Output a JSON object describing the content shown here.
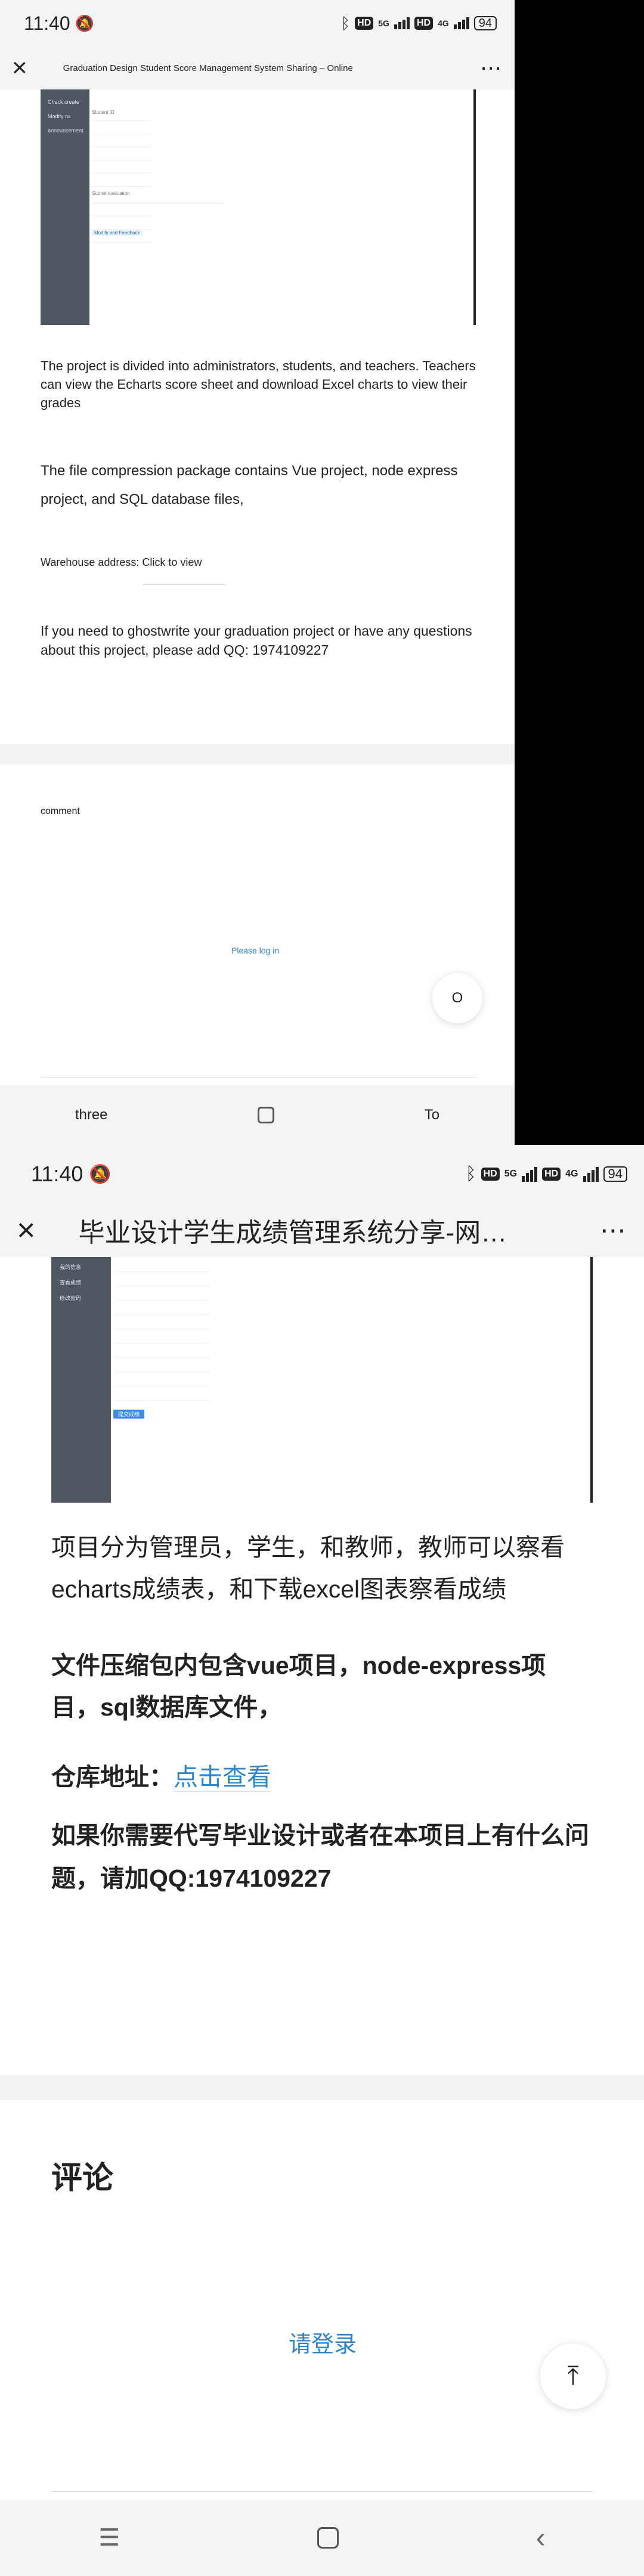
{
  "top": {
    "time": "11:40",
    "network_5g": "5G",
    "network_4g": "4G",
    "hd": "HD",
    "battery": "94",
    "title": "Graduation Design Student Score Management System Sharing – Online",
    "shot_texts": [
      "Check create",
      "Modify ru",
      "announcement",
      "Student ID",
      "Submit evaluation",
      "Modify and Feedback"
    ],
    "p1": "The project is divided into administrators, students, and teachers. Teachers can view the Echarts score sheet and download Excel charts to view their grades",
    "p2": "The file compression package contains Vue project, node express project, and SQL database files,",
    "warehouse": "Warehouse address: Click to view",
    "qq": "If you need to ghostwrite your graduation project or have any questions about this project, please add QQ: 1974109227",
    "comment": "comment",
    "login": "Please log in",
    "fab": "O",
    "nav_left": "three",
    "nav_right": "To"
  },
  "bottom": {
    "time": "11:40",
    "network_5g": "5G",
    "network_4g": "4G",
    "hd": "HD",
    "battery": "94",
    "title": "毕业设计学生成绩管理系统分享-网…",
    "side_items": [
      "我的信息",
      "查看成绩",
      "修改密码"
    ],
    "shot_button": "提交成绩",
    "p1": "项目分为管理员，学生，和教师，教师可以察看echarts成绩表，和下载excel图表察看成绩",
    "p2": "文件压缩包内包含vue项目，node-express项目，sql数据库文件，",
    "warehouse_label": "仓库地址：",
    "warehouse_link": "点击查看",
    "qq": "如果你需要代写毕业设计或者在本项目上有什么问题，请加QQ:1974109227",
    "comment": "评论",
    "login": "请登录",
    "fab": "⤒"
  },
  "colors": {
    "link": "#2f86c7",
    "sidebar": "#4f5862",
    "gap": "#f2f3f5"
  }
}
